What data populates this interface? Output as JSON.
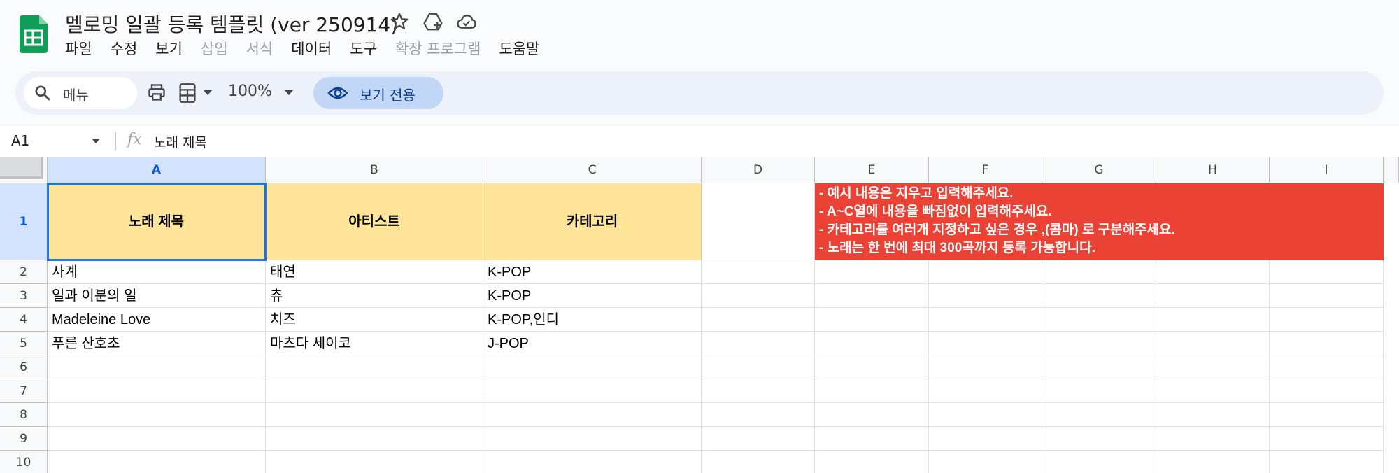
{
  "doc": {
    "title": "멜로밍 일괄 등록 템플릿 (ver 250914)"
  },
  "menu": [
    {
      "label": "파일",
      "enabled": true
    },
    {
      "label": "수정",
      "enabled": true
    },
    {
      "label": "보기",
      "enabled": true
    },
    {
      "label": "삽입",
      "enabled": false
    },
    {
      "label": "서식",
      "enabled": false
    },
    {
      "label": "데이터",
      "enabled": true
    },
    {
      "label": "도구",
      "enabled": true
    },
    {
      "label": "확장 프로그램",
      "enabled": false
    },
    {
      "label": "도움말",
      "enabled": true
    }
  ],
  "toolbar": {
    "search_label": "메뉴",
    "zoom": "100%",
    "view_only_label": "보기 전용"
  },
  "formula_bar": {
    "cell_ref": "A1",
    "fx": "fx",
    "content": "노래 제목"
  },
  "columns": [
    "A",
    "B",
    "C",
    "D",
    "E",
    "F",
    "G",
    "H",
    "I"
  ],
  "rows": [
    "1",
    "2",
    "3",
    "4",
    "5",
    "6",
    "7",
    "8",
    "9",
    "10"
  ],
  "sheet": {
    "headers": [
      "노래 제목",
      "아티스트",
      "카테고리"
    ],
    "data": [
      [
        "사계",
        "태연",
        "K-POP"
      ],
      [
        "일과 이분의 일",
        "츄",
        "K-POP"
      ],
      [
        "Madeleine Love",
        "치즈",
        "K-POP,인디"
      ],
      [
        "푸른 산호초",
        "마츠다 세이코",
        "J-POP"
      ]
    ],
    "notice": [
      "- 예시 내용은 지우고 입력해주세요.",
      "- A~C열에 내용을 빠짐없이 입력해주세요.",
      "- 카테고리를 여러개 지정하고 싶은 경우 ,(콤마) 로 구분해주세요.",
      "- 노래는 한 번에 최대 300곡까지 등록 가능합니다."
    ]
  },
  "colors": {
    "header_fill": "#ffe599",
    "notice_fill": "#ea4335",
    "selection": "#1a73e8",
    "sheets_green": "#0f9d58"
  }
}
